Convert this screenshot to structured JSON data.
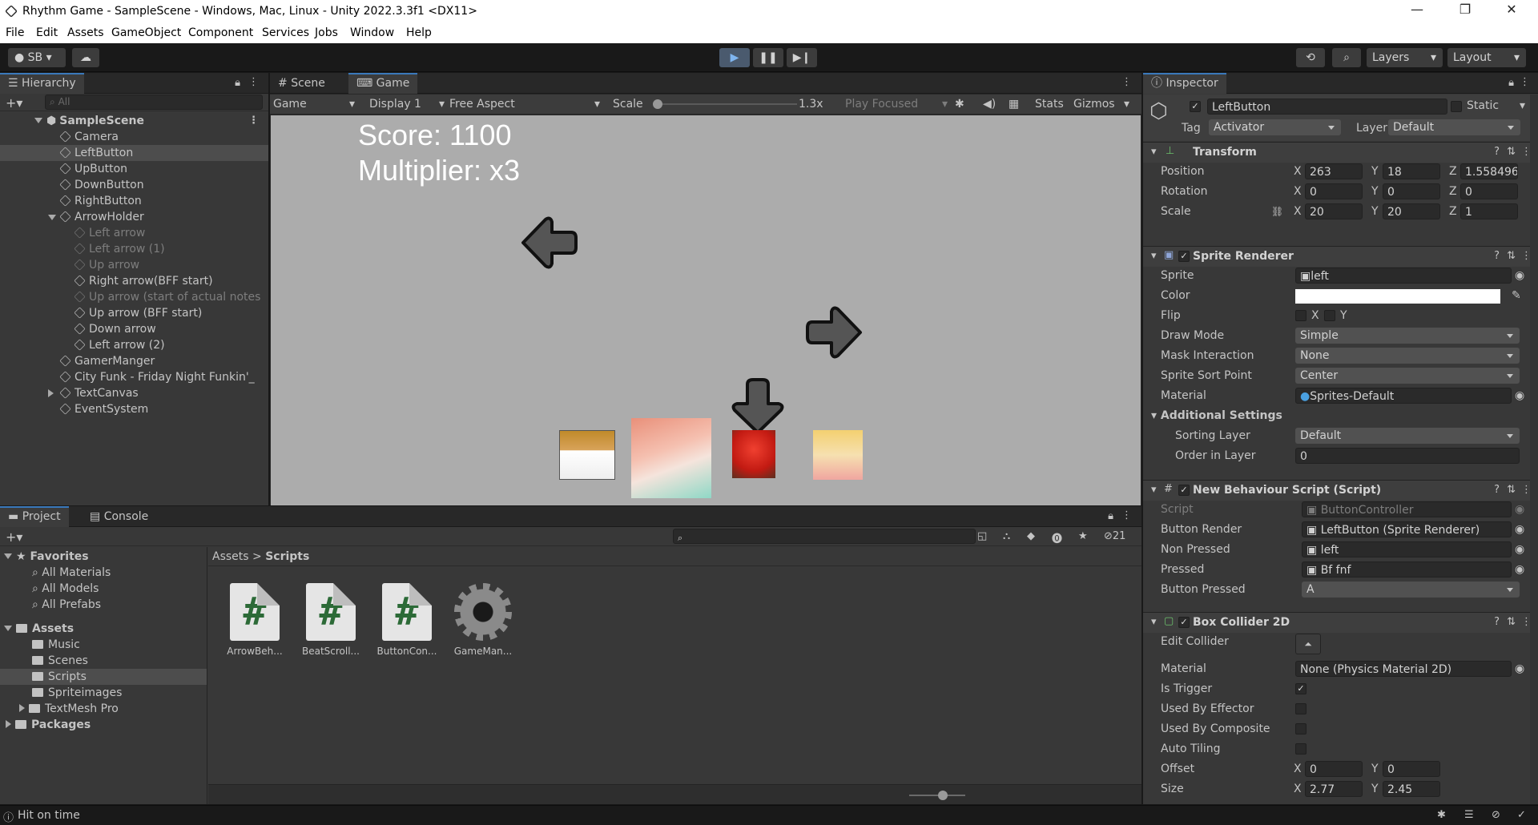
{
  "window": {
    "title": "Rhythm Game - SampleScene - Windows, Mac, Linux - Unity 2022.3.3f1 <DX11>"
  },
  "menu": [
    "File",
    "Edit",
    "Assets",
    "GameObject",
    "Component",
    "Services",
    "Jobs",
    "Window",
    "Help"
  ],
  "toolbar": {
    "account": "SB",
    "layers": "Layers",
    "layout": "Layout"
  },
  "hierarchy": {
    "tab": "Hierarchy",
    "search_placeholder": "All",
    "scene": "SampleScene",
    "items": [
      {
        "label": "Camera",
        "depth": 1,
        "dim": false
      },
      {
        "label": "LeftButton",
        "depth": 1,
        "dim": false,
        "selected": true
      },
      {
        "label": "UpButton",
        "depth": 1,
        "dim": false
      },
      {
        "label": "DownButton",
        "depth": 1,
        "dim": false
      },
      {
        "label": "RightButton",
        "depth": 1,
        "dim": false
      },
      {
        "label": "ArrowHolder",
        "depth": 1,
        "dim": false,
        "expanded": true
      },
      {
        "label": "Left arrow",
        "depth": 2,
        "dim": true
      },
      {
        "label": "Left arrow  (1)",
        "depth": 2,
        "dim": true
      },
      {
        "label": "Up arrow",
        "depth": 2,
        "dim": true
      },
      {
        "label": "Right arrow(BFF start)",
        "depth": 2,
        "dim": false
      },
      {
        "label": "Up arrow (start of actual notes",
        "depth": 2,
        "dim": true
      },
      {
        "label": "Up arrow (BFF start)",
        "depth": 2,
        "dim": false
      },
      {
        "label": "Down arrow",
        "depth": 2,
        "dim": false
      },
      {
        "label": "Left arrow  (2)",
        "depth": 2,
        "dim": false
      },
      {
        "label": "GamerManger",
        "depth": 1,
        "dim": false
      },
      {
        "label": "City Funk - Friday Night Funkin'_",
        "depth": 1,
        "dim": false
      },
      {
        "label": "TextCanvas",
        "depth": 1,
        "dim": false,
        "collapsed": true
      },
      {
        "label": "EventSystem",
        "depth": 1,
        "dim": false
      }
    ]
  },
  "game": {
    "tabs": {
      "scene": "Scene",
      "game": "Game"
    },
    "controls": {
      "mode": "Game",
      "display": "Display 1",
      "aspect": "Free Aspect",
      "scale_label": "Scale",
      "scale_value": "1.3x",
      "play_focused": "Play Focused",
      "stats": "Stats",
      "gizmos": "Gizmos"
    },
    "score": "Score: 1100",
    "multiplier": "Multiplier: x3"
  },
  "project": {
    "tabs": {
      "project": "Project",
      "console": "Console"
    },
    "hidden_count": "21",
    "favorites": {
      "label": "Favorites",
      "items": [
        "All Materials",
        "All Models",
        "All Prefabs"
      ]
    },
    "assets": {
      "label": "Assets",
      "items": [
        "Music",
        "Scenes",
        "Scripts",
        "Spriteimages",
        "TextMesh Pro"
      ]
    },
    "packages": "Packages",
    "breadcrumb": [
      "Assets",
      "Scripts"
    ],
    "files": [
      "ArrowBeh...",
      "BeatScroll...",
      "ButtonCon...",
      "GameMan..."
    ]
  },
  "inspector": {
    "tab": "Inspector",
    "object_name": "LeftButton",
    "static_label": "Static",
    "tag_label": "Tag",
    "tag": "Activator",
    "layer_label": "Layer",
    "layer": "Default",
    "transform": {
      "title": "Transform",
      "position": {
        "label": "Position",
        "x": "263",
        "y": "18",
        "z": "1.558496"
      },
      "rotation": {
        "label": "Rotation",
        "x": "0",
        "y": "0",
        "z": "0"
      },
      "scale": {
        "label": "Scale",
        "x": "20",
        "y": "20",
        "z": "1"
      }
    },
    "sprite_renderer": {
      "title": "Sprite Renderer",
      "sprite_label": "Sprite",
      "sprite": "left",
      "color_label": "Color",
      "color": "#ffffff",
      "flip_label": "Flip",
      "flip_x": "X",
      "flip_y": "Y",
      "draw_mode_label": "Draw Mode",
      "draw_mode": "Simple",
      "mask_label": "Mask Interaction",
      "mask": "None",
      "sort_point_label": "Sprite Sort Point",
      "sort_point": "Center",
      "material_label": "Material",
      "material": "Sprites-Default",
      "additional": "Additional Settings",
      "sorting_layer_label": "Sorting Layer",
      "sorting_layer": "Default",
      "order_label": "Order in Layer",
      "order": "0"
    },
    "script": {
      "title": "New Behaviour Script (Script)",
      "script_label": "Script",
      "script": "ButtonController",
      "button_render_label": "Button Render",
      "button_render": "LeftButton (Sprite Renderer)",
      "non_pressed_label": "Non Pressed",
      "non_pressed": "left",
      "pressed_label": "Pressed",
      "pressed": "Bf fnf",
      "button_pressed_label": "Button Pressed",
      "button_pressed": "A"
    },
    "box_collider": {
      "title": "Box Collider 2D",
      "edit_label": "Edit Collider",
      "material_label": "Material",
      "material": "None (Physics Material 2D)",
      "is_trigger_label": "Is Trigger",
      "effector_label": "Used By Effector",
      "composite_label": "Used By Composite",
      "tiling_label": "Auto Tiling",
      "offset_label": "Offset",
      "offset_x": "0",
      "offset_y": "0",
      "size_label": "Size",
      "size_x": "2.77",
      "size_y": "2.45"
    }
  },
  "status": {
    "message": "Hit on time"
  }
}
